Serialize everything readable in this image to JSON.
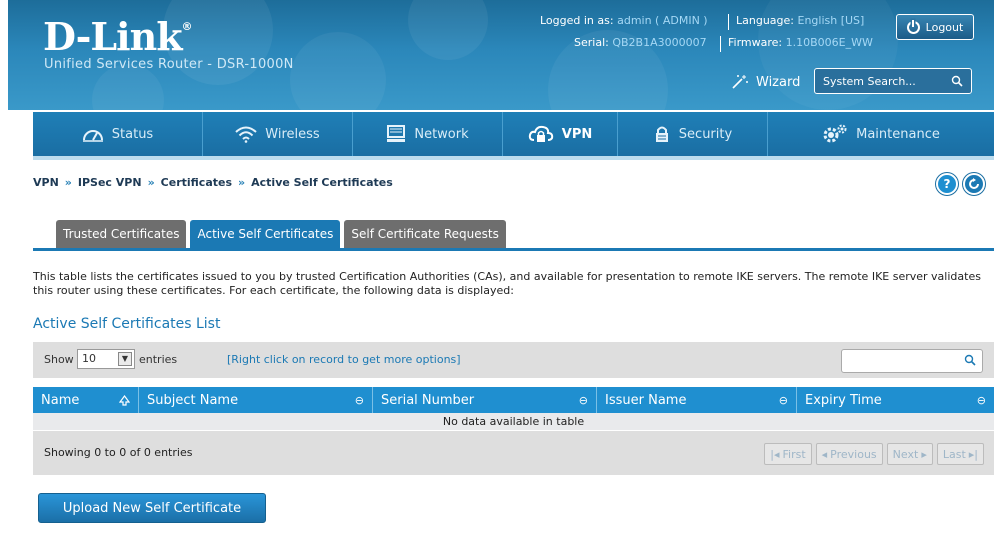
{
  "header": {
    "brand": "D-Link",
    "brand_mark": "®",
    "product": "Unified Services Router - DSR-1000N",
    "logged_in_label": "Logged in as:",
    "logged_in_value": "admin ( ADMIN )",
    "language_label": "Language:",
    "language_value": "English [US]",
    "serial_label": "Serial:",
    "serial_value": "QB2B1A3000007",
    "firmware_label": "Firmware:",
    "firmware_value": "1.10B006E_WW",
    "logout_label": "Logout",
    "wizard_label": "Wizard",
    "search_placeholder": "System Search..."
  },
  "nav": {
    "items": [
      {
        "label": "Status",
        "icon": "dashboard-icon"
      },
      {
        "label": "Wireless",
        "icon": "wifi-icon"
      },
      {
        "label": "Network",
        "icon": "monitor-icon"
      },
      {
        "label": "VPN",
        "icon": "cloud-lock-icon",
        "active": true
      },
      {
        "label": "Security",
        "icon": "lock-icon"
      },
      {
        "label": "Maintenance",
        "icon": "gears-icon"
      }
    ]
  },
  "breadcrumb": {
    "items": [
      "VPN",
      "IPSec VPN",
      "Certificates",
      "Active Self Certificates"
    ],
    "separator": "»"
  },
  "tabs": [
    {
      "label": "Trusted Certificates",
      "active": false
    },
    {
      "label": "Active Self Certificates",
      "active": true
    },
    {
      "label": "Self Certificate Requests",
      "active": false
    }
  ],
  "description": "This table lists the certificates issued to you by trusted Certification Authorities (CAs), and available for presentation to remote IKE servers. The remote IKE server validates this router using these certificates. For each certificate, the following data is displayed:",
  "list_title": "Active Self Certificates List",
  "table": {
    "show_label": "Show",
    "page_size": "10",
    "entries_label": "entries",
    "hint": "[Right click on record to get more options]",
    "columns": [
      "Name",
      "Subject Name",
      "Serial Number",
      "Issuer Name",
      "Expiry Time"
    ],
    "empty_message": "No data available in table",
    "showing": "Showing 0 to 0 of 0 entries",
    "pager": {
      "first": "First",
      "previous": "Previous",
      "next": "Next",
      "last": "Last"
    }
  },
  "upload_button": "Upload New Self Certificate",
  "colors": {
    "accent": "#1b79b4",
    "header_bg": "#2b87ba",
    "tab_inactive": "#6e6e6e",
    "table_header": "#1f8fd0"
  }
}
